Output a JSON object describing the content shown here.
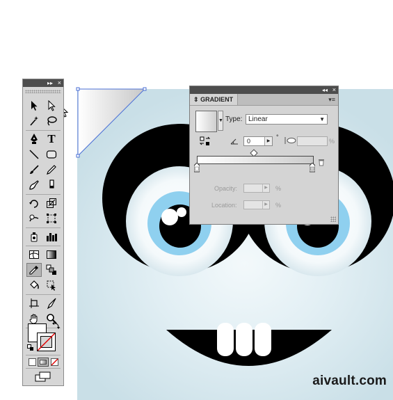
{
  "watermark": "aivault.com",
  "tools_panel": {
    "collapse_icon": "▸▸",
    "close_icon": "×",
    "tools": [
      {
        "name": "selection-tool",
        "icon": "selection-arrow-icon"
      },
      {
        "name": "direct-selection-tool",
        "icon": "direct-selection-arrow-icon"
      },
      {
        "name": "magic-wand-tool",
        "icon": "magic-wand-icon"
      },
      {
        "name": "lasso-tool",
        "icon": "lasso-icon"
      },
      {
        "name": "pen-tool",
        "icon": "pen-icon"
      },
      {
        "name": "type-tool",
        "icon": "type-icon",
        "glyph": "T"
      },
      {
        "name": "line-segment-tool",
        "icon": "line-icon"
      },
      {
        "name": "rectangle-tool",
        "icon": "rectangle-icon"
      },
      {
        "name": "paintbrush-tool",
        "icon": "paintbrush-icon"
      },
      {
        "name": "pencil-tool",
        "icon": "pencil-icon"
      },
      {
        "name": "blob-brush-tool",
        "icon": "blob-brush-icon"
      },
      {
        "name": "eraser-tool",
        "icon": "eraser-icon"
      },
      {
        "name": "rotate-tool",
        "icon": "rotate-icon"
      },
      {
        "name": "scale-tool",
        "icon": "scale-icon"
      },
      {
        "name": "warp-tool",
        "icon": "warp-icon"
      },
      {
        "name": "free-transform-tool",
        "icon": "free-transform-icon"
      },
      {
        "name": "symbol-sprayer-tool",
        "icon": "symbol-sprayer-icon"
      },
      {
        "name": "column-graph-tool",
        "icon": "column-graph-icon"
      },
      {
        "name": "mesh-tool",
        "icon": "mesh-icon"
      },
      {
        "name": "gradient-tool",
        "icon": "gradient-icon"
      },
      {
        "name": "eyedropper-tool",
        "icon": "eyedropper-icon",
        "active": true
      },
      {
        "name": "blend-tool",
        "icon": "blend-icon"
      },
      {
        "name": "live-paint-bucket-tool",
        "icon": "paint-bucket-icon"
      },
      {
        "name": "live-paint-selection-tool",
        "icon": "live-paint-selection-icon"
      },
      {
        "name": "artboard-tool",
        "icon": "artboard-icon"
      },
      {
        "name": "slice-tool",
        "icon": "slice-icon"
      },
      {
        "name": "hand-tool",
        "icon": "hand-icon"
      },
      {
        "name": "zoom-tool",
        "icon": "zoom-icon"
      }
    ],
    "fill_color": "#ffffff",
    "stroke": "none"
  },
  "gradient_panel": {
    "collapse_icon": "◂◂",
    "close_icon": "×",
    "tab_label": "GRADIENT",
    "tab_arrows": "⇕",
    "menu_icon": "▾≡",
    "type_label": "Type:",
    "type_value": "Linear",
    "angle_value": "0",
    "degree_symbol": "°",
    "aspect_unit": "%",
    "opacity_label": "Opacity:",
    "opacity_unit": "%",
    "location_label": "Location:",
    "location_unit": "%",
    "gradient_start_color": "#ffffff",
    "gradient_end_color": "#cccccc"
  },
  "colors": {
    "artboard_center": "#f3f9fb",
    "artboard_edge": "#c9dfe7",
    "iris": "#8fd0ef",
    "ui_dark": "#4d4d4d",
    "panel_bg": "#d4d4d4"
  }
}
